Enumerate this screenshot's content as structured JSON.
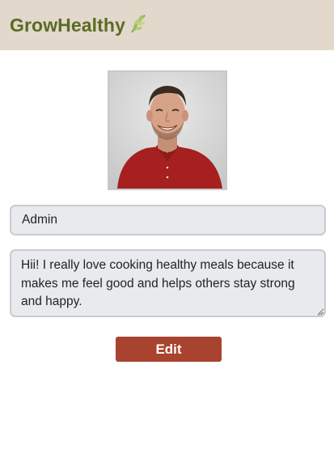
{
  "header": {
    "brand": "GrowHealthy",
    "brand_icon": "leaf-icon",
    "background": "#e2d8cc",
    "brand_color": "#5b6b23"
  },
  "profile": {
    "photo": "profile-photo",
    "name_value": "Admin",
    "bio_value": "Hii! I really love cooking healthy meals because it makes me feel good and helps others stay strong and happy."
  },
  "actions": {
    "edit_label": "Edit",
    "edit_color": "#a8432f"
  }
}
